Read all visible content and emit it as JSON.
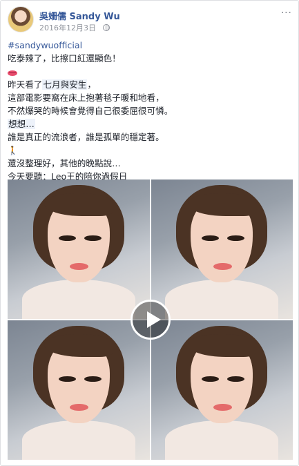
{
  "post": {
    "author": "吳姍儒 Sandy Wu",
    "date": "2016年12月3日",
    "visibility_icon": "globe-icon",
    "more_icon": "more-options-icon",
    "hashtag": "#sandywuofficial",
    "lines": [
      "吃泰辣了，比擦口紅還顯色！",
      "",
      "昨天看了",
      "這部電影要窩在床上抱著毯子暖和地看，",
      "不然爆哭的時候會覺得自己很委屈很可憐。",
      "想想…",
      "誰是真正的流浪者，誰是孤單的穩定著。",
      "",
      "還沒整理好，其他的晚點說…",
      "今天要聽：Leo王的陪你過假日"
    ],
    "movie_title": "七月與安生",
    "line3_suffix": "，",
    "line6_prefix": "想想…",
    "emoji_1": "kiss-lips-icon",
    "emoji_2": "walking-person-icon"
  },
  "media": {
    "type": "video",
    "play_icon": "play-icon"
  }
}
